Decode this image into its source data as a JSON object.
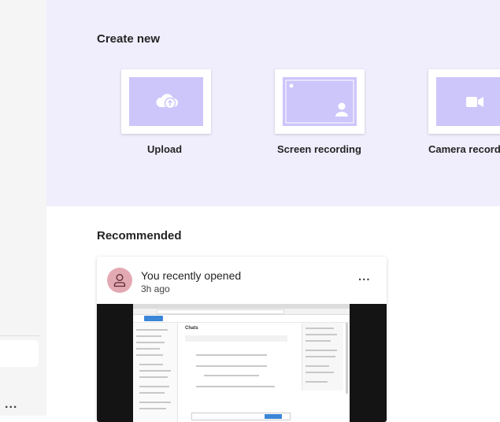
{
  "sidebar": {
    "more_label": "..."
  },
  "create_new": {
    "title": "Create new",
    "tiles": [
      {
        "label": "Upload",
        "icon": "cloud-upload-icon"
      },
      {
        "label": "Screen recording",
        "icon": "screen-recording-icon"
      },
      {
        "label": "Camera record",
        "icon": "video-camera-icon"
      }
    ]
  },
  "recommended": {
    "title": "Recommended",
    "card": {
      "heading": "You recently opened",
      "time": "3h ago",
      "more_label": "...",
      "preview": {
        "page_title": "Chats"
      }
    }
  },
  "colors": {
    "band": "#f0eefd",
    "thumb": "#cdc6fb",
    "avatar": "#e3a9b2"
  }
}
